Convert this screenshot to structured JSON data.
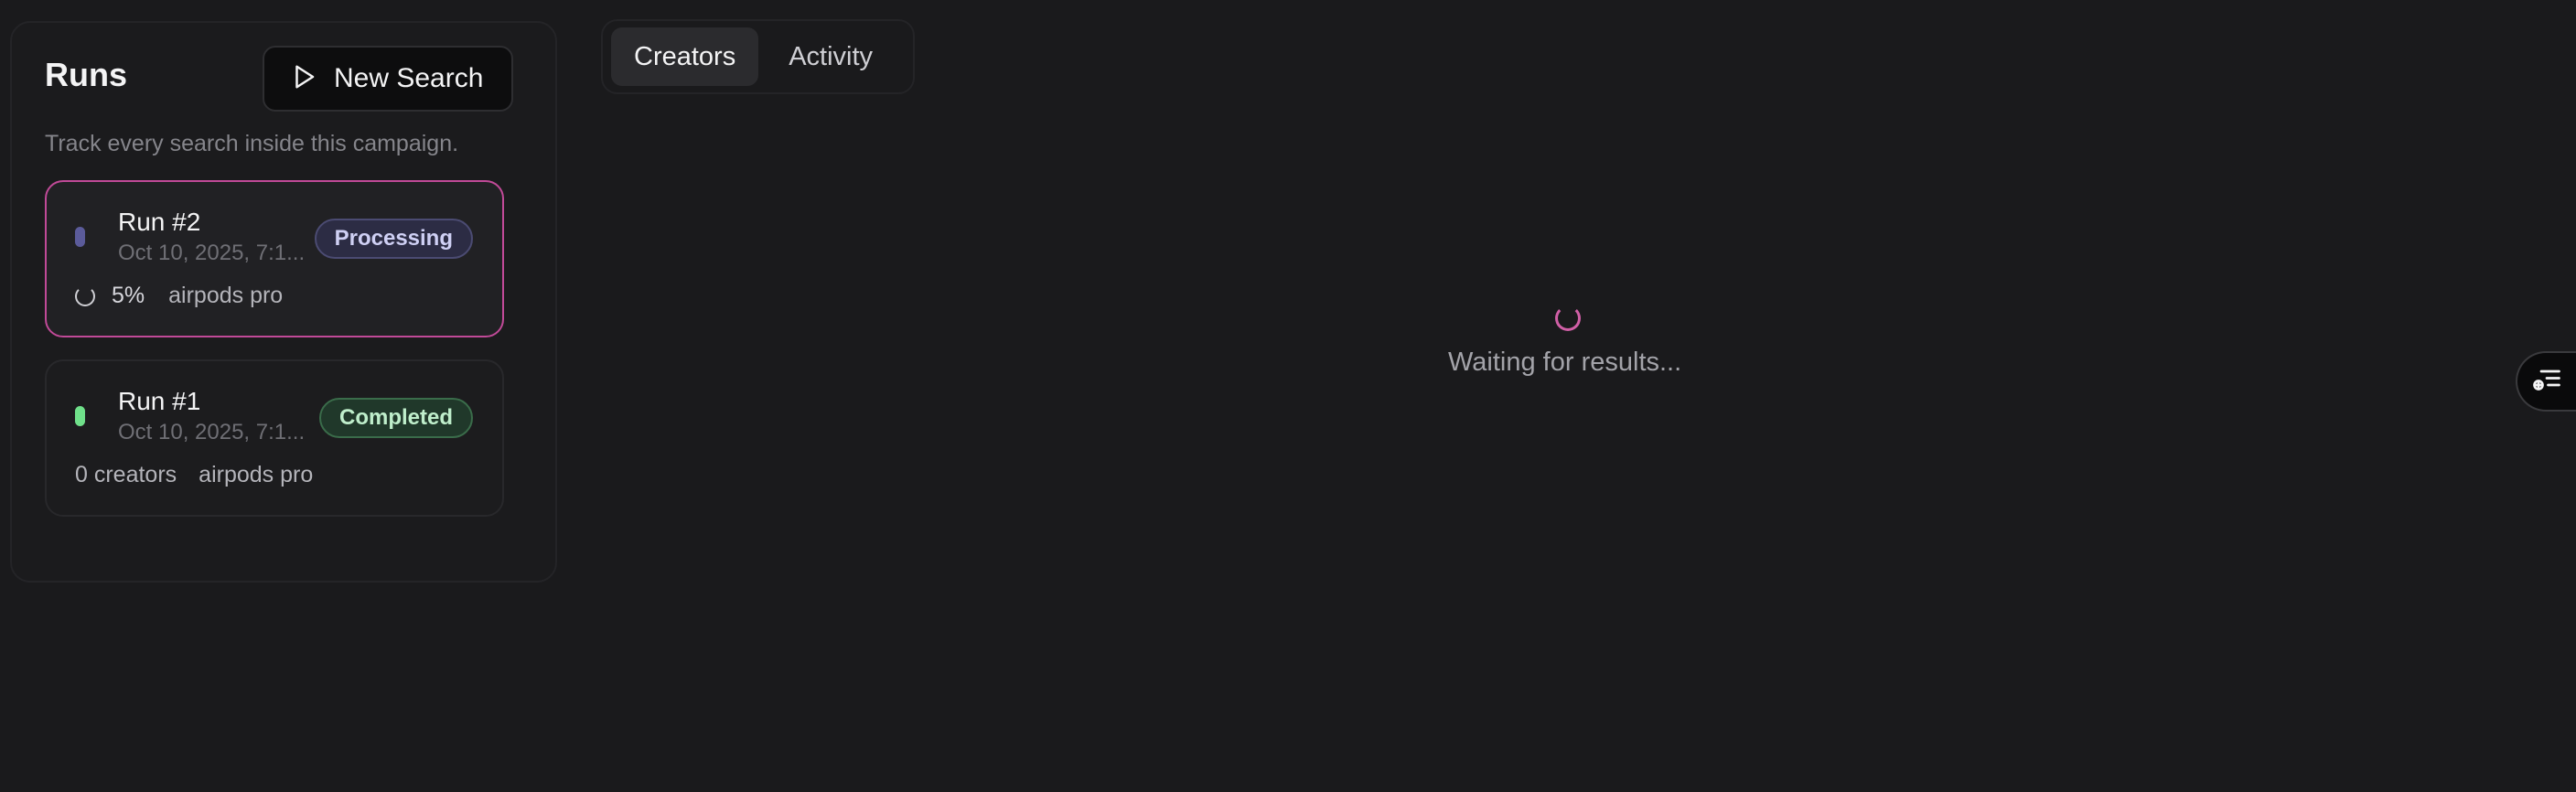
{
  "runs_panel": {
    "title": "Runs",
    "subtitle": "Track every search inside this campaign.",
    "new_search_label": "New Search"
  },
  "runs": [
    {
      "name": "Run #2",
      "date": "Oct 10, 2025, 7:1...",
      "status": "Processing",
      "progress": "5%",
      "query": "airpods pro",
      "dot_color": "#5b5b9a"
    },
    {
      "name": "Run #1",
      "date": "Oct 10, 2025, 7:1...",
      "status": "Completed",
      "creators": "0 creators",
      "query": "airpods pro",
      "dot_color": "#6fe08a"
    }
  ],
  "tabs": [
    {
      "label": "Creators",
      "active": true
    },
    {
      "label": "Activity",
      "active": false
    }
  ],
  "main": {
    "waiting_text": "Waiting for results..."
  },
  "colors": {
    "accent": "#c14a98",
    "spinner": "#d05fa6",
    "background": "#1a1a1c"
  }
}
